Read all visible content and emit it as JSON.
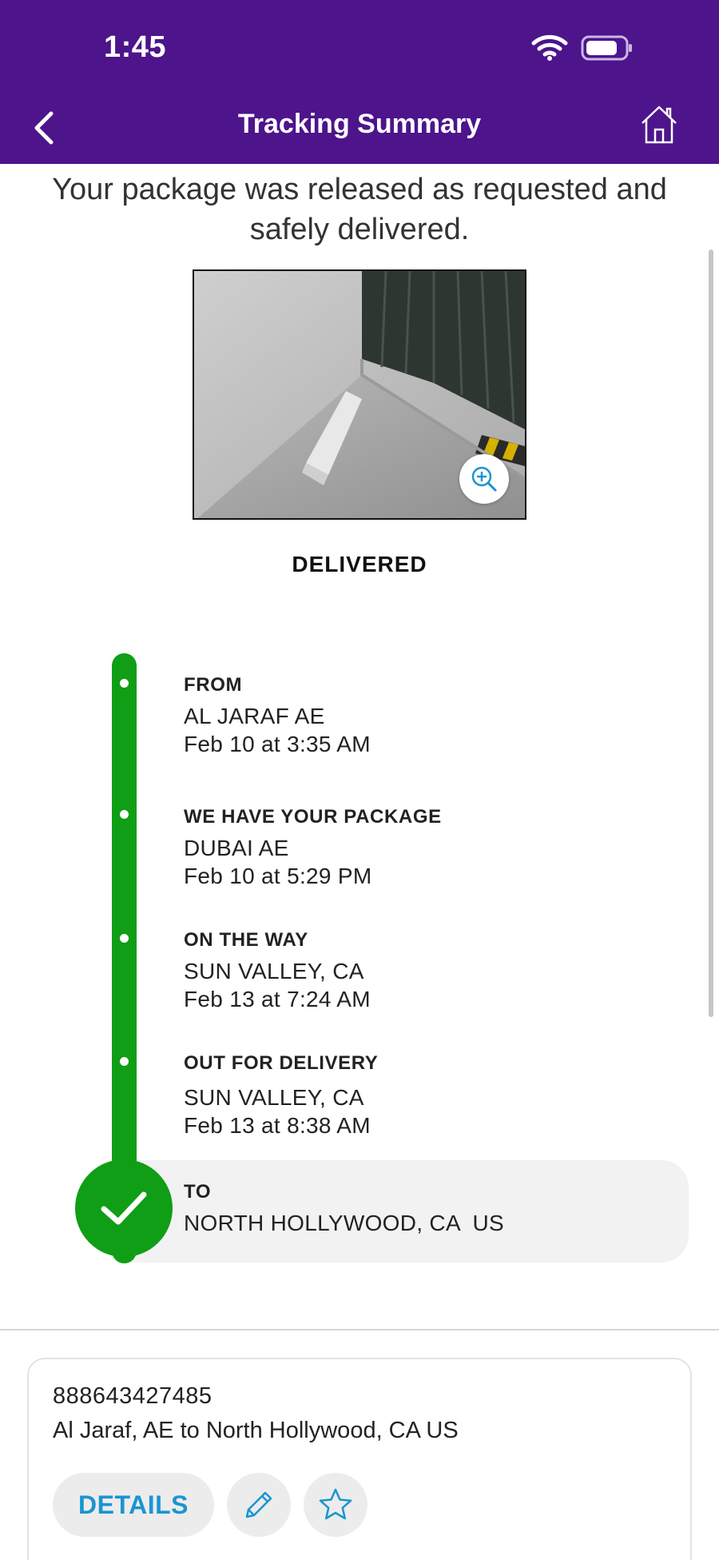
{
  "status_bar": {
    "time": "1:45",
    "wifi_icon": "wifi-icon",
    "battery_icon": "battery-icon"
  },
  "header": {
    "title": "Tracking Summary",
    "back_icon": "chevron-left-icon",
    "home_icon": "home-icon",
    "background_color": "#4d148c"
  },
  "message": "Your package was released as requested and safely delivered.",
  "photo": {
    "zoom_icon": "zoom-in-icon"
  },
  "status": "DELIVERED",
  "timeline": {
    "color": "#0f9e15",
    "events": [
      {
        "title": "FROM",
        "location": "AL JARAF AE",
        "time": "Feb 10 at 3:35 AM"
      },
      {
        "title": "WE HAVE YOUR PACKAGE",
        "location": "DUBAI AE",
        "time": "Feb 10 at 5:29 PM"
      },
      {
        "title": "ON THE WAY",
        "location": "SUN VALLEY, CA",
        "time": "Feb 13 at 7:24 AM"
      },
      {
        "title": "OUT FOR DELIVERY",
        "location": "SUN VALLEY, CA",
        "time": "Feb 13 at 8:38 AM"
      }
    ],
    "destination": {
      "title": "TO",
      "location": "NORTH HOLLYWOOD, CA  US",
      "icon": "check-icon"
    }
  },
  "shipment": {
    "tracking_number": "888643427485",
    "route": "Al Jaraf, AE to North Hollywood, CA US",
    "details_label": "DETAILS",
    "edit_icon": "pencil-icon",
    "favorite_icon": "star-icon",
    "accent_color": "#1a95d1"
  }
}
